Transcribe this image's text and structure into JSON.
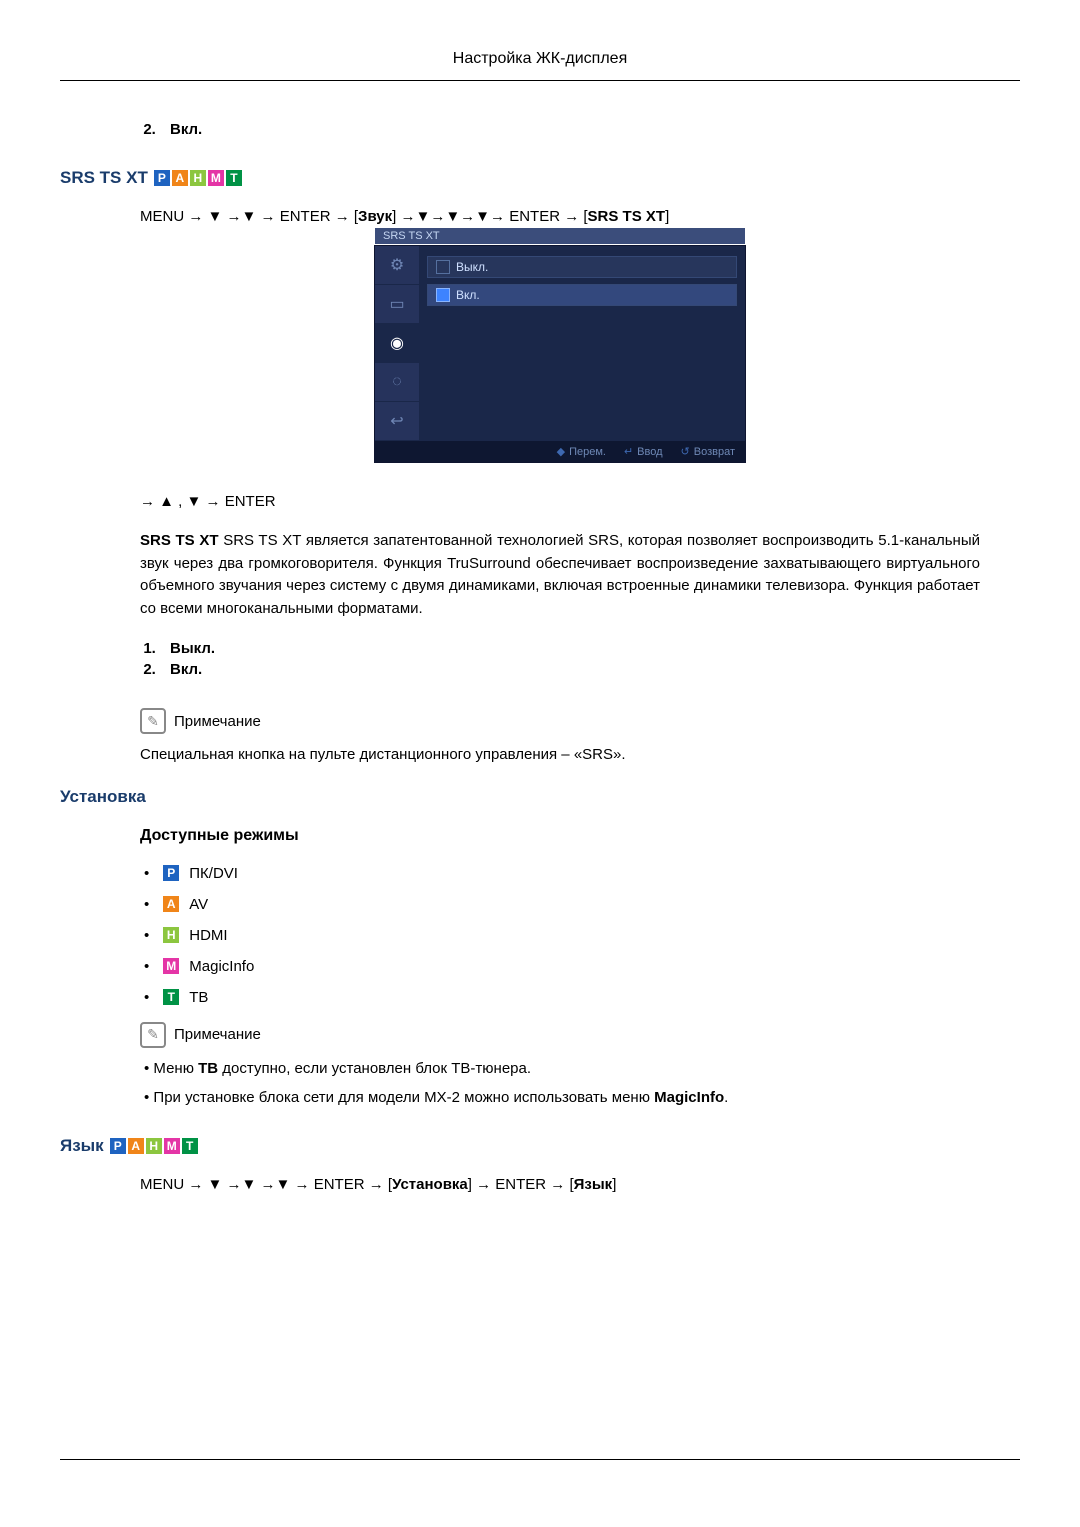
{
  "header": {
    "title": "Настройка ЖК-дисплея"
  },
  "lead_list": {
    "start": 2,
    "item": "Вкл."
  },
  "section_srs": {
    "title": "SRS TS XT",
    "badges": [
      "P",
      "A",
      "H",
      "M",
      "T"
    ],
    "menu_path_1": {
      "prefix": "MENU ",
      "parts": [
        "→",
        "▼",
        "→",
        "▼",
        "→ ENTER →",
        "[",
        "Звук",
        "]",
        "→",
        "▼",
        "→",
        "▼",
        "→",
        "▼",
        "→ ENTER →",
        "[",
        "SRS TS XT",
        "]"
      ]
    },
    "osd": {
      "title": "SRS TS XT",
      "side_icons": [
        "⚙",
        "▭",
        "◉",
        "◌",
        "↩"
      ],
      "options": [
        {
          "label": "Выкл.",
          "selected": false
        },
        {
          "label": "Вкл.",
          "selected": true
        }
      ],
      "footer": {
        "move": "Перем.",
        "enter": "Ввод",
        "return": "Возврат"
      }
    },
    "menu_path_2": "→ ▲ , ▼ → ENTER",
    "description": "SRS TS XT является запатентованной технологией SRS, которая позволяет воспроизводить 5.1-канальный звук через два громкоговорителя. Функция TruSurround обеспечивает воспроизведение захватывающего виртуального объемного звучания через систему с двумя динамиками, включая встроенные динамики телевизора. Функция работает со всеми многоканальными форматами.",
    "options": [
      "Выкл.",
      "Вкл."
    ],
    "note_title": "Примечание",
    "note_text": "Специальная кнопка на пульте дистанционного управления – «SRS»."
  },
  "section_setup": {
    "title": "Установка",
    "modes_title": "Доступные режимы",
    "modes": [
      {
        "badge": "P",
        "cls": "b-P",
        "label": "ПК/DVI"
      },
      {
        "badge": "A",
        "cls": "b-A",
        "label": "AV"
      },
      {
        "badge": "H",
        "cls": "b-H",
        "label": "HDMI"
      },
      {
        "badge": "M",
        "cls": "b-M",
        "label": "MagicInfo"
      },
      {
        "badge": "T",
        "cls": "b-T",
        "label": "ТВ"
      }
    ],
    "note_title": "Примечание",
    "notes": [
      "Меню ТВ доступно, если установлен блок ТВ-тюнера.",
      "При установке блока сети для модели MX-2 можно использовать меню MagicInfo."
    ],
    "notes_bold": {
      "0": "ТВ",
      "1": "MagicInfo"
    }
  },
  "section_lang": {
    "title": "Язык",
    "badges": [
      "P",
      "A",
      "H",
      "M",
      "T"
    ],
    "menu_path": {
      "tokens": [
        "MENU ",
        "→",
        "▼",
        "→",
        "▼",
        "→",
        "▼",
        "→ ENTER →",
        "[",
        "Установка",
        "]",
        "→ ENTER →",
        "[",
        "Язык",
        "]"
      ]
    }
  }
}
